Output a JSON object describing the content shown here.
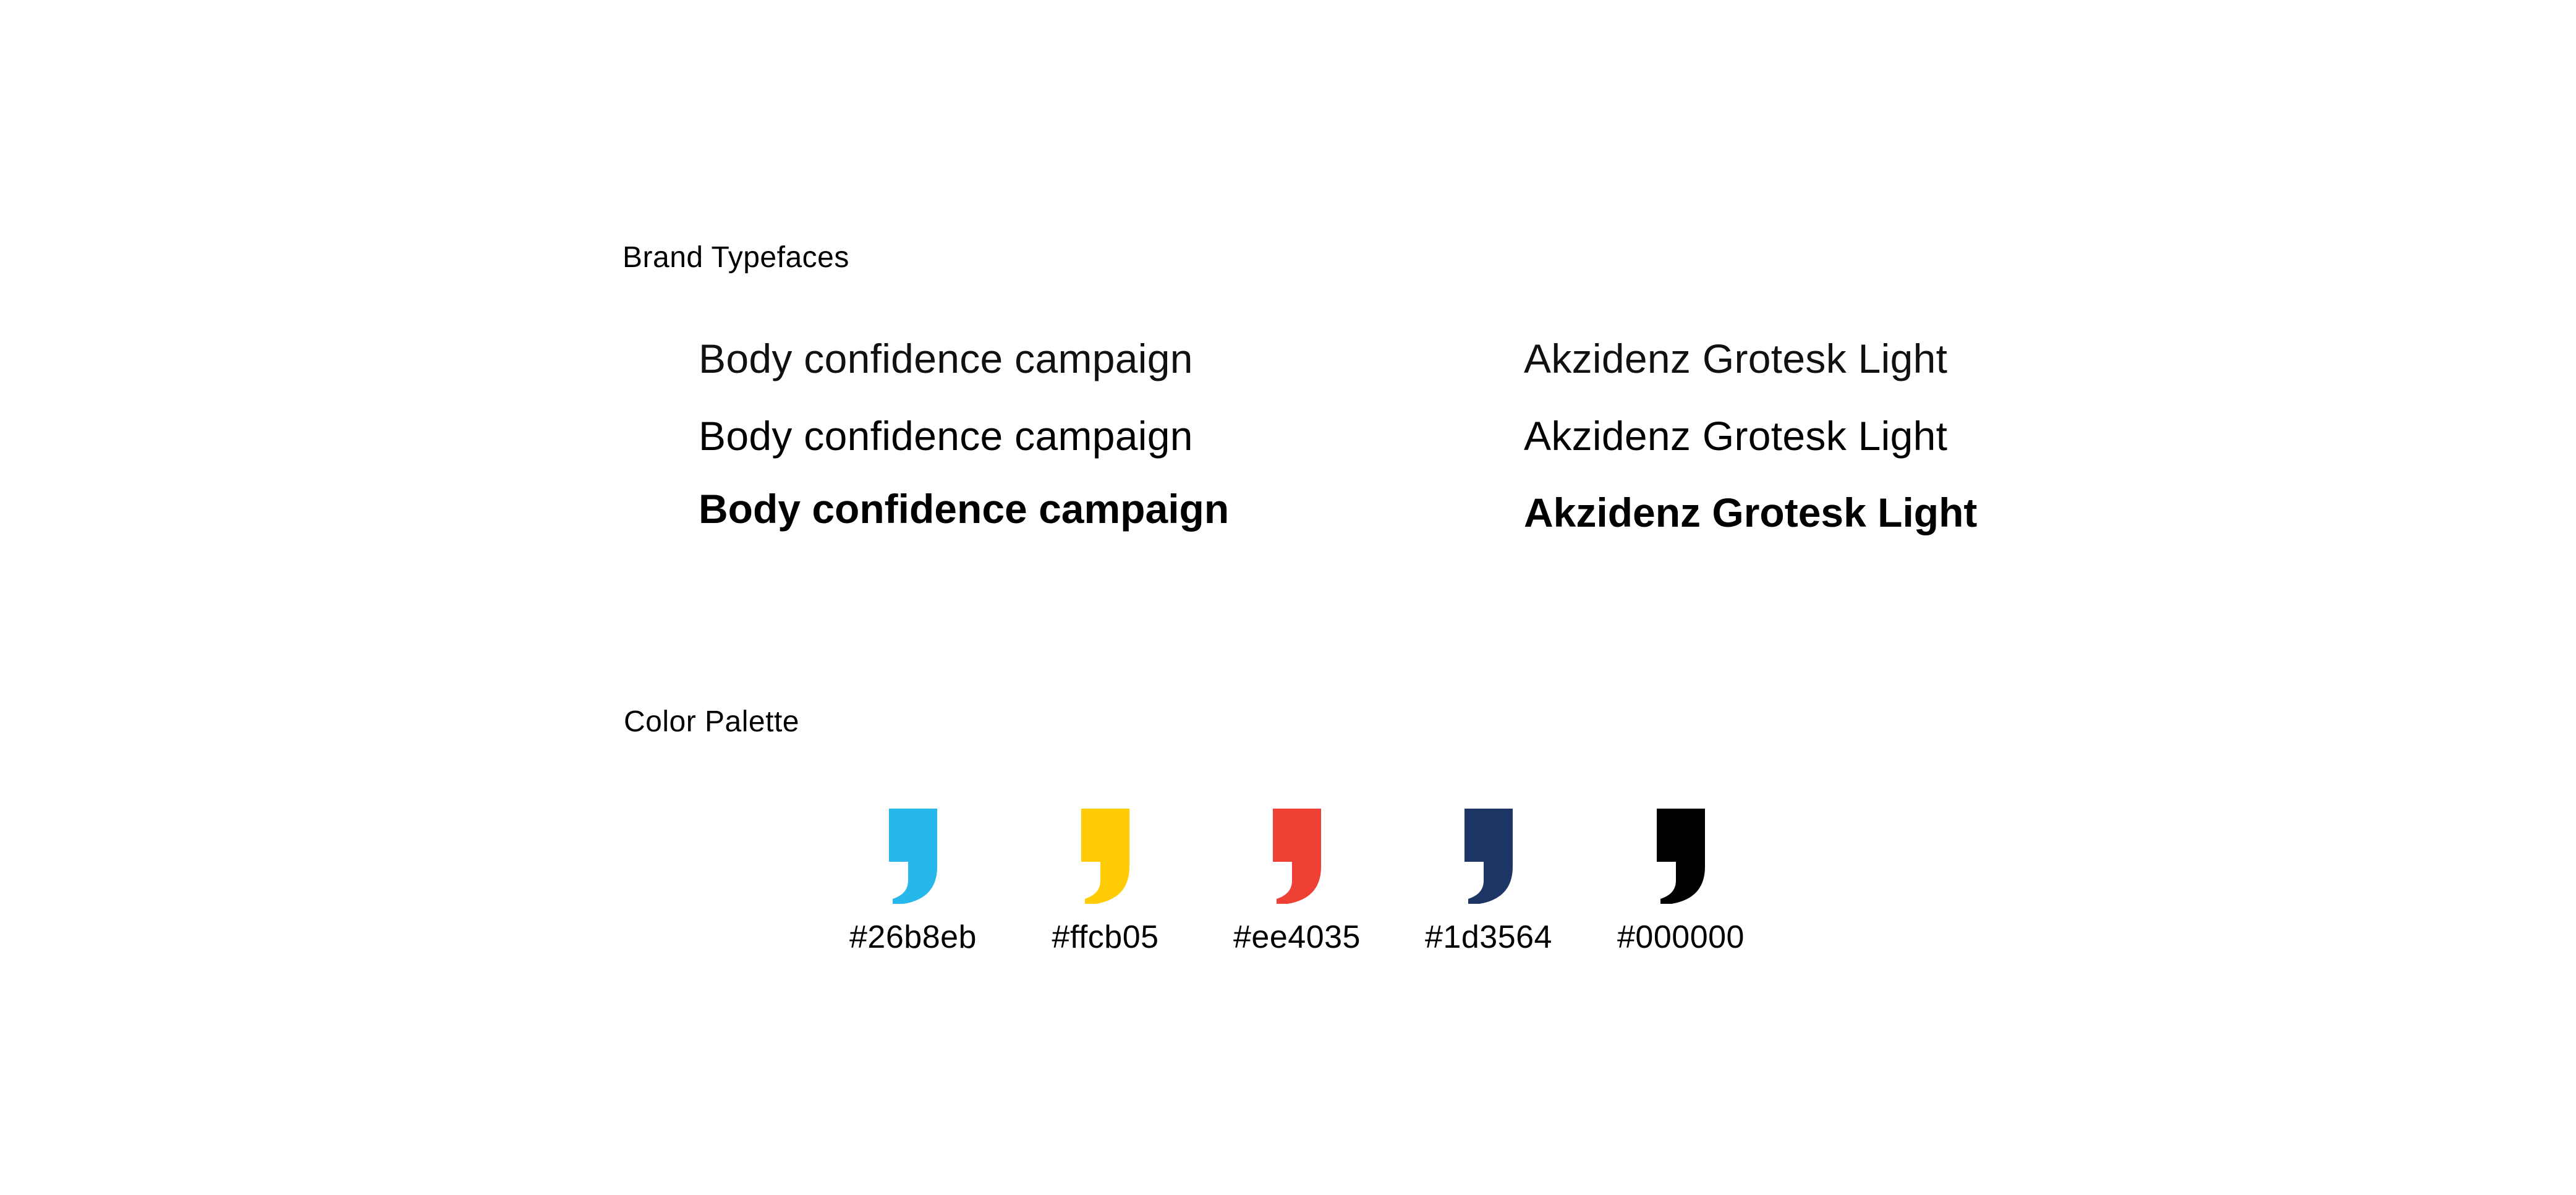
{
  "typefaces": {
    "title": "Brand Typefaces",
    "left_samples": [
      "Body confidence campaign",
      "Body confidence campaign",
      "Body confidence campaign"
    ],
    "right_samples": [
      "Akzidenz Grotesk Light",
      "Akzidenz Grotesk Light",
      "Akzidenz Grotesk Light"
    ]
  },
  "palette": {
    "title": "Color Palette",
    "swatches": [
      {
        "label": "#26b8eb",
        "color": "#26b8eb",
        "icon": "comma-icon"
      },
      {
        "label": "#ffcb05",
        "color": "#ffcb05",
        "icon": "comma-icon"
      },
      {
        "label": "#ee4035",
        "color": "#ee4035",
        "icon": "comma-icon"
      },
      {
        "label": "#1d3564",
        "color": "#1d3564",
        "icon": "comma-icon"
      },
      {
        "label": "#000000",
        "color": "#000000",
        "icon": "comma-icon"
      }
    ]
  }
}
